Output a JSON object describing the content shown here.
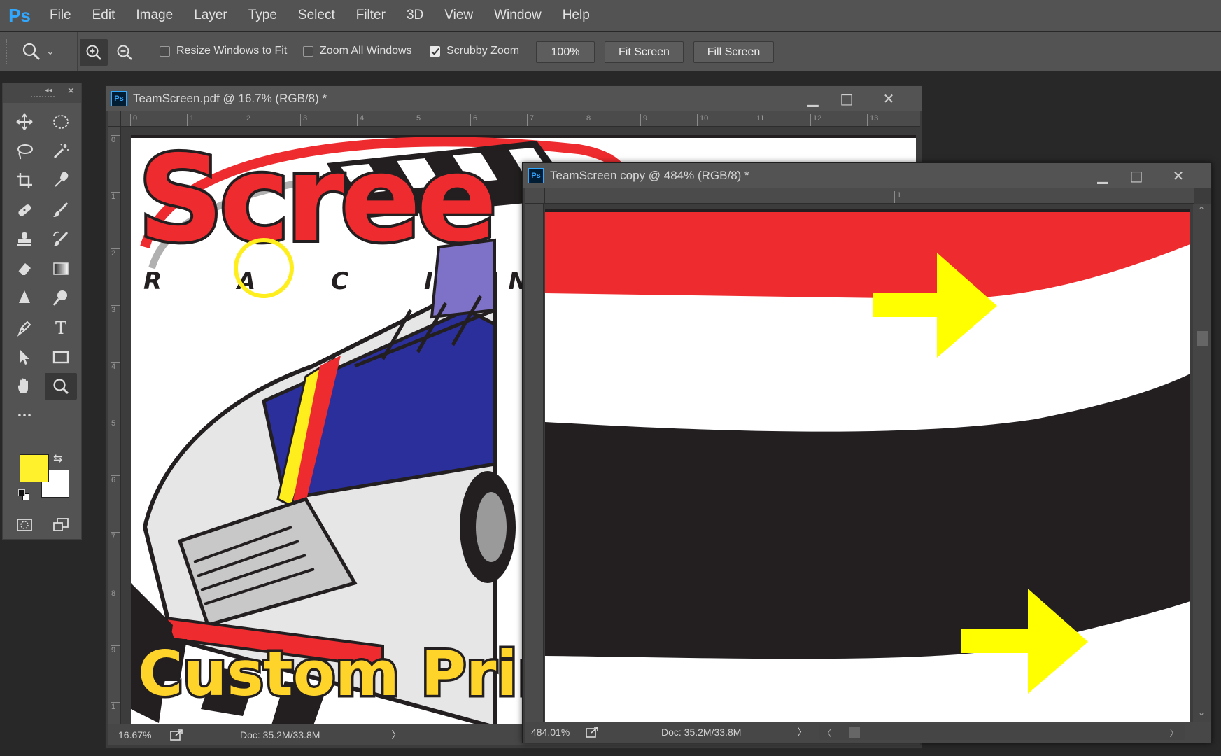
{
  "app": {
    "logo": "Ps",
    "menu": [
      "File",
      "Edit",
      "Image",
      "Layer",
      "Type",
      "Select",
      "Filter",
      "3D",
      "View",
      "Window",
      "Help"
    ]
  },
  "options": {
    "resize_windows": {
      "label": "Resize Windows to Fit",
      "checked": false
    },
    "zoom_all": {
      "label": "Zoom All Windows",
      "checked": false
    },
    "scrubby": {
      "label": "Scrubby Zoom",
      "checked": true
    },
    "zoom_value": "100%",
    "fit_screen": "Fit Screen",
    "fill_screen": "Fill Screen"
  },
  "tools": {
    "items": [
      "move",
      "elliptical-marquee",
      "lasso",
      "magic-wand",
      "crop",
      "eyedropper",
      "healing-brush",
      "brush",
      "clone-stamp",
      "history-brush",
      "eraser",
      "gradient",
      "blur",
      "dodge",
      "pen",
      "type",
      "path-selection",
      "rectangle",
      "hand",
      "zoom",
      "more"
    ],
    "selected": "zoom",
    "type_glyph": "T",
    "more_glyph": "•••",
    "foreground_color": "#fff22d",
    "background_color": "#ffffff"
  },
  "doc1": {
    "badge": "Ps",
    "title": "TeamScreen.pdf @ 16.7% (RGB/8) *",
    "zoom": "16.67%",
    "doc_size": "Doc: 35.2M/33.8M",
    "ruler_top": [
      "0",
      "1",
      "2",
      "3",
      "4",
      "5",
      "6",
      "7",
      "8",
      "9",
      "10",
      "11",
      "12",
      "13"
    ],
    "ruler_left": [
      "0",
      "1",
      "2",
      "3",
      "4",
      "5",
      "6",
      "7",
      "8",
      "9",
      "1"
    ],
    "artwork": {
      "headline": "Scree",
      "subhead": "R A C I N",
      "footer": "Custom Prin"
    }
  },
  "doc2": {
    "badge": "Ps",
    "title": "TeamScreen copy @ 484% (RGB/8) *",
    "zoom": "484.01%",
    "doc_size": "Doc: 35.2M/33.8M",
    "ruler_top": [
      "1"
    ]
  },
  "colors": {
    "red": "#ee2b2e",
    "yellow": "#ffee1d",
    "black": "#231f20",
    "blue": "#2b2f9c"
  },
  "glyphs": {
    "minimize": "▁",
    "maximize": "□",
    "close": "✕",
    "collapse": "◂◂",
    "panel_close": "✕",
    "chevron": "⌄",
    "scroll_right": "〉",
    "scroll_left": "〈",
    "scroll_end": "〉",
    "scroll_up": "⌃",
    "scroll_down": "⌄",
    "swap": "⇆"
  }
}
